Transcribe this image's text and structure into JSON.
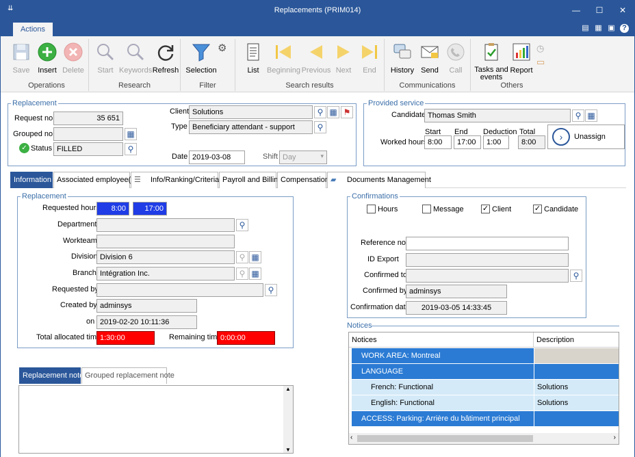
{
  "window": {
    "title": "Replacements (PRIM014)",
    "minimize": "—",
    "maximize": "☐",
    "close": "✕",
    "system": "⇊"
  },
  "ribbon": {
    "tab": "Actions",
    "groups": {
      "operations": "Operations",
      "research": "Research",
      "filter": "Filter",
      "search_results": "Search results",
      "communications": "Communications",
      "others": "Others"
    },
    "buttons": {
      "save": "Save",
      "insert": "Insert",
      "delete": "Delete",
      "start": "Start",
      "keywords": "Keywords",
      "refresh": "Refresh",
      "selection": "Selection",
      "list": "List",
      "beginning": "Beginning",
      "previous": "Previous",
      "next": "Next",
      "end": "End",
      "history": "History",
      "send": "Send",
      "call": "Call",
      "tasks": "Tasks and events",
      "report": "Report"
    }
  },
  "replacement": {
    "legend": "Replacement",
    "request_no_label": "Request no.",
    "request_no": "35 651",
    "grouped_no_label": "Grouped no.",
    "grouped_no": "",
    "status_label": "Status",
    "status": "FILLED",
    "client_label": "Client",
    "client": "Solutions",
    "type_label": "Type",
    "type": "Beneficiary attendant - support",
    "date_label": "Date",
    "date": "2019-03-08",
    "shift_label": "Shift",
    "shift": "Day"
  },
  "provided": {
    "legend": "Provided service",
    "candidate_label": "Candidate",
    "candidate": "Thomas Smith",
    "worked_label": "Worked hours",
    "start_label": "Start",
    "start": "8:00",
    "end_label": "End",
    "end": "17:00",
    "deduction_label": "Deduction",
    "deduction": "1:00",
    "total_label": "Total",
    "total": "8:00",
    "unassign": "Unassign"
  },
  "tabs": [
    "Information",
    "Associated employee(s)",
    "Info/Ranking/Criteria",
    "Payroll and Billing",
    "Compensation",
    "Documents Management"
  ],
  "info": {
    "legend": "Replacement",
    "requested_hours_label": "Requested hours",
    "req_start": "8:00",
    "req_end": "17:00",
    "department_label": "Department",
    "department": "",
    "workteam_label": "Workteam",
    "workteam": "",
    "division_label": "Division",
    "division": "Division 6",
    "branch_label": "Branch",
    "branch": "Intégration Inc.",
    "requested_by_label": "Requested by",
    "requested_by": "",
    "created_by_label": "Created by",
    "created_by": "adminsys",
    "on_label": "on",
    "on": "2019-02-20 10:11:36",
    "total_alloc_label": "Total allocated time",
    "total_alloc": "1:30:00",
    "remaining_label": "Remaining time",
    "remaining": "0:00:00"
  },
  "confirmations": {
    "legend": "Confirmations",
    "hours": "Hours",
    "message": "Message",
    "client": "Client",
    "candidate": "Candidate",
    "hours_checked": false,
    "message_checked": false,
    "client_checked": true,
    "candidate_checked": true,
    "reference_label": "Reference no.",
    "reference": "",
    "id_export_label": "ID Export",
    "id_export": "",
    "confirmed_to_label": "Confirmed to",
    "confirmed_to": "",
    "confirmed_by_label": "Confirmed by",
    "confirmed_by": "adminsys",
    "conf_date_label": "Confirmation date",
    "conf_date": "2019-03-05 14:33:45"
  },
  "notices": {
    "legend": "Notices",
    "col1": "Notices",
    "col2": "Description",
    "rows": [
      {
        "notice": "WORK AREA: Montreal",
        "description": ""
      },
      {
        "notice": "LANGUAGE",
        "description": ""
      },
      {
        "notice": "French: Functional",
        "description": "Solutions"
      },
      {
        "notice": "English: Functional",
        "description": "Solutions"
      },
      {
        "notice": "ACCESS: Parking: Arrière du bâtiment principal",
        "description": ""
      }
    ]
  },
  "note_tabs": [
    "Replacement note",
    "Grouped replacement note"
  ],
  "colors": {
    "accent": "#2b579a",
    "row_dark": "#2b7bd4",
    "row_light": "#d4eaf8",
    "req_blue": "#1f3ce6",
    "alert_red": "#ff0000"
  }
}
